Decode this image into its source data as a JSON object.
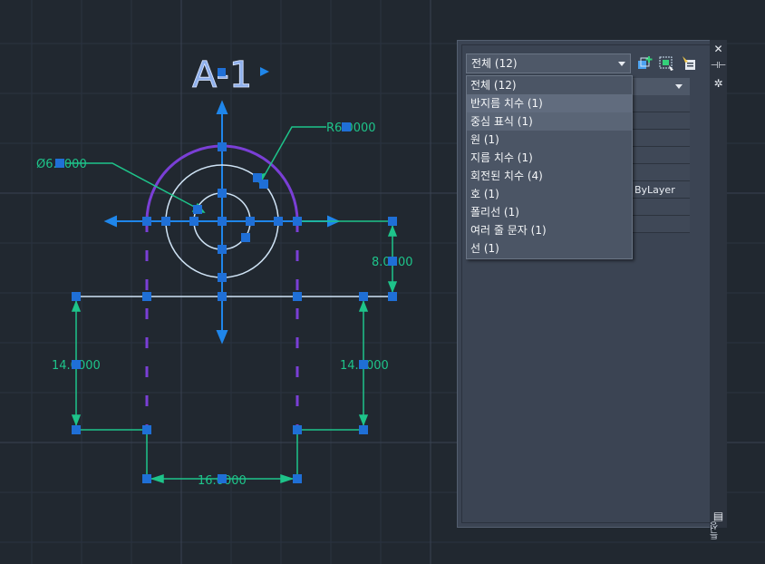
{
  "drawing": {
    "title": "A-1",
    "dim_radius": "R6.0000",
    "dim_diameter": "Ø6.0000",
    "dim_height_right": "8.0000",
    "dim_left_vertical": "14.0000",
    "dim_right_vertical": "14.0000",
    "dim_bottom": "16.0000",
    "colors": {
      "dimension": "#1ec48a",
      "grip": "#1f6fd6",
      "arc": "#7a3fd6",
      "axis": "#1f86ea",
      "line": "#cfe3f5"
    }
  },
  "properties_panel": {
    "selection_filter": "전체 (12)",
    "toolbar_icons": [
      "add-selection-icon",
      "quick-select-icon",
      "toggle-pickadd-icon"
    ],
    "property_rows": [
      "",
      "",
      "",
      "",
      "",
      "",
      "ByLayer",
      "",
      ""
    ],
    "dropdown_items": [
      "전체 (12)",
      "반지름 치수 (1)",
      "중심 표식 (1)",
      "원 (1)",
      "지름 치수 (1)",
      "회전된 치수 (4)",
      "호 (1)",
      "폴리선 (1)",
      "여러 줄 문자 (1)",
      "선 (1)"
    ],
    "strip_label": "특성"
  }
}
